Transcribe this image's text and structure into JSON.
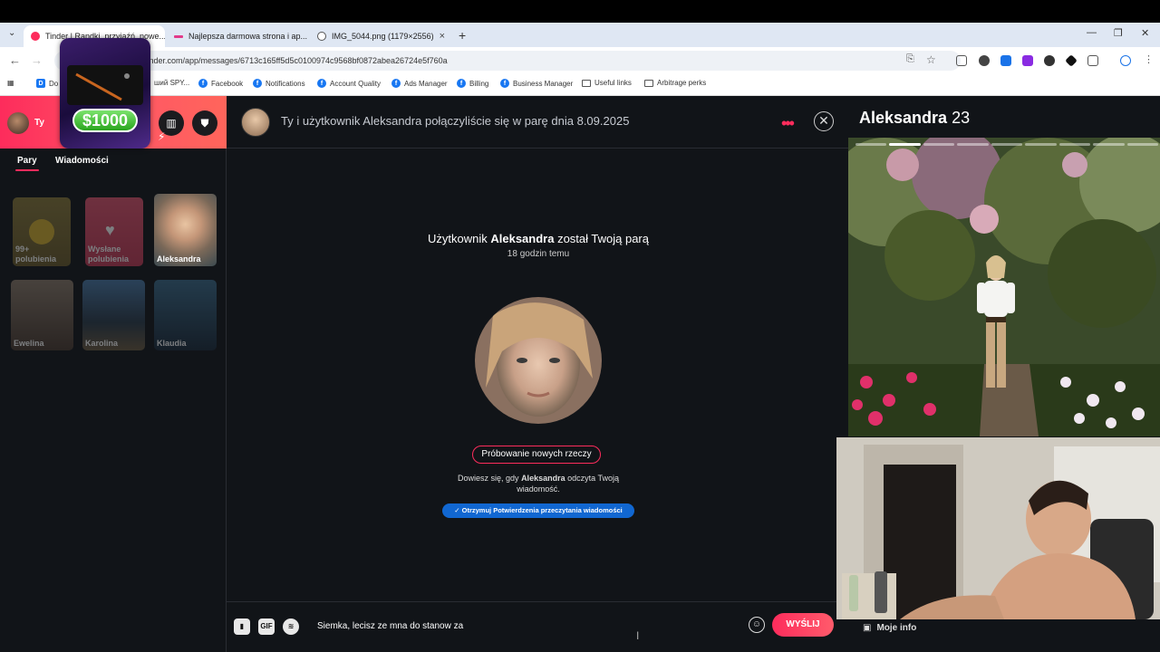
{
  "browser": {
    "tabs": [
      {
        "title": "Tinder | Randki, przyjaźń, nowe..."
      },
      {
        "title": "Najlepsza darmowa strona i ap..."
      },
      {
        "title": "IMG_5044.png (1179×2556)"
      }
    ],
    "url": "tinder.com/app/messages/6713c165ff5d5c0100974c9568bf0872abea26724e5f760a",
    "url_prefix": "Do",
    "bookmarks": [
      "ший SPY...",
      "Facebook",
      "Notifications",
      "Account Quality",
      "Ads Manager",
      "Billing",
      "Business Manager",
      "Useful links",
      "Arbitrage perks"
    ]
  },
  "sidebar": {
    "me_label": "Ty",
    "promo_amount": "$1000",
    "tabs": [
      "Pary",
      "Wiadomości"
    ],
    "cards": [
      {
        "name": "99+ polubienia"
      },
      {
        "name": "Wysłane polubienia"
      },
      {
        "name": "Aleksandra"
      },
      {
        "name": "Ewelina"
      },
      {
        "name": "Karolina"
      },
      {
        "name": "Klaudia"
      }
    ]
  },
  "chat": {
    "header_title": "Ty i użytkownik Aleksandra połączyliście się w parę dnia 8.09.2025",
    "match_prefix": "Użytkownik ",
    "match_name": "Aleksandra",
    "match_suffix": " został Twoją parą",
    "match_time": "18 godzin temu",
    "interest_pill": "Próbowanie nowych rzeczy",
    "notice_prefix": "Dowiesz się, gdy ",
    "notice_name": "Aleksandra",
    "notice_suffix": " odczyta Twoją wiadomość.",
    "receipts_button": "✓ Otrzymuj Potwierdzenia przeczytania wiadomości",
    "composer": {
      "gif_label": "GIF",
      "message_value": "Siemka, lecisz ze mna do stanow za",
      "send_label": "WYŚLIJ"
    }
  },
  "profile": {
    "name": "Aleksandra",
    "age": "23",
    "photo_count": 9,
    "active_photo": 1,
    "info_link": "Moje info"
  },
  "colors": {
    "tinder_pink": "#fd2c5c",
    "receipt_blue": "#1167d1",
    "background": "#111418"
  }
}
